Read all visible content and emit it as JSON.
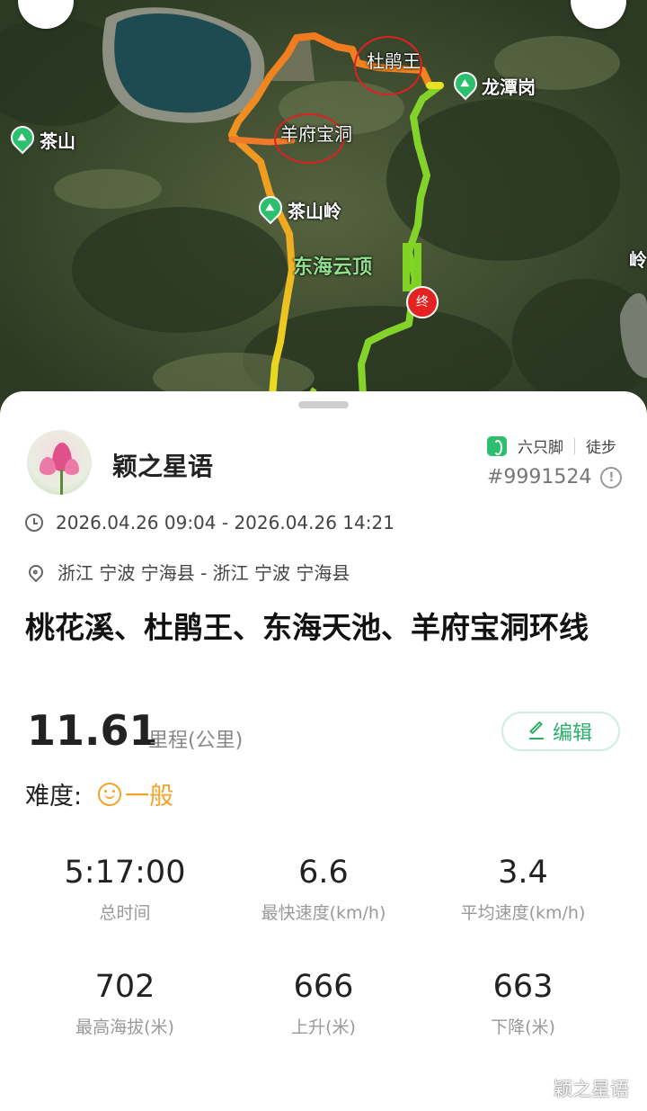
{
  "map": {
    "labels": {
      "dujuanwang": "杜鹃王",
      "longtangang": "龙潭岗",
      "chashan": "茶山",
      "yangfubaodong": "羊府宝洞",
      "chashanling": "茶山岭",
      "donghaiyunding": "东海云顶",
      "ling_edge": "岭",
      "end_marker": "终"
    }
  },
  "user": {
    "name": "颖之星语"
  },
  "brand": {
    "app_name": "六只脚",
    "activity_type": "徒步",
    "trip_id": "#9991524",
    "info_icon_text": "!"
  },
  "trip": {
    "time_range": "2026.04.26 09:04 - 2026.04.26 14:21",
    "location": "浙江 宁波 宁海县 - 浙江 宁波 宁海县",
    "title": "桃花溪、杜鹃王、东海天池、羊府宝洞环线",
    "distance": "11.61",
    "distance_unit": "里程(公里)",
    "edit_label": "编辑",
    "difficulty_label": "难度:",
    "difficulty_value": "一般"
  },
  "stats": [
    {
      "value": "5:17:00",
      "label": "总时间"
    },
    {
      "value": "6.6",
      "label": "最快速度(km/h)"
    },
    {
      "value": "3.4",
      "label": "平均速度(km/h)"
    },
    {
      "value": "702",
      "label": "最高海拔(米)"
    },
    {
      "value": "666",
      "label": "上升(米)"
    },
    {
      "value": "663",
      "label": "下降(米)"
    }
  ],
  "watermark": "颖之星语",
  "colors": {
    "accent": "#2bbf6e",
    "difficulty": "#f1a32a",
    "track_fast": "#f08a1e",
    "track_slow": "#7ed321"
  }
}
